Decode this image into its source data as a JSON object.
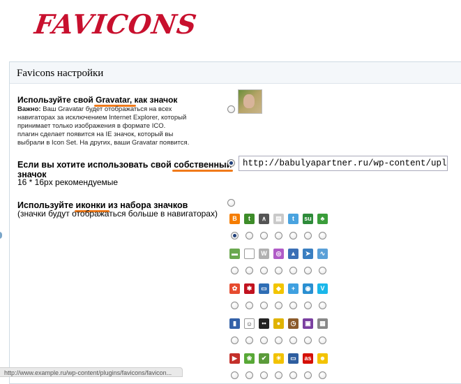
{
  "logo": {
    "text": "FAVICONS"
  },
  "panel": {
    "title": "Favicons настройки"
  },
  "gravatar_option": {
    "heading_pre": "Используйте свой ",
    "heading_u": "Gravatar, ",
    "heading_post": "как значок",
    "note_label": "Важно:",
    "note_lines": [
      " Ваш Gravatar будет отображаться на всех",
      "навигаторах за исключением Internet Explorer, который",
      "принимает только изображения в формате ICO.",
      "плагин сделает появится на IE значок, который вы",
      "выбрали в Icon Set. На других, ваши Gravatar появится."
    ],
    "selected": false
  },
  "custom_option": {
    "heading_pre": "Если вы хотите использовать свой ",
    "heading_u": "собственный",
    "heading_line2": "значок",
    "hint": "16 * 16px рекомендуемые",
    "url_value": "http://babulyapartner.ru/wp-content/uploac",
    "selected": true
  },
  "iconset_option": {
    "heading_pre": "Используйте ",
    "heading_u": "иконки ",
    "heading_post": "из набора значков",
    "sub": "(значки будут отображаться больше в навигаторах)",
    "selected": false
  },
  "icon_rows": [
    {
      "icons": [
        {
          "name": "blogger-icon",
          "color": "#f57d00",
          "glyph": "B"
        },
        {
          "name": "brightkite-icon",
          "color": "#3d8c29",
          "glyph": "t"
        },
        {
          "name": "bebo-icon",
          "color": "#555555",
          "glyph": "∧"
        },
        {
          "name": "posterous-icon",
          "color": "#c9c9c9",
          "glyph": "▤"
        },
        {
          "name": "twitter-icon",
          "color": "#4aa3df",
          "glyph": "t"
        },
        {
          "name": "stumbleupon-icon",
          "color": "#2e8b3a",
          "glyph": "su"
        },
        {
          "name": "tree-icon",
          "color": "#3a9d3a",
          "glyph": "♣"
        }
      ],
      "selected": 0
    },
    {
      "icons": [
        {
          "name": "landscape-icon",
          "color": "#6aa84f",
          "glyph": "▬"
        },
        {
          "name": "blank-icon",
          "color": "#ffffff",
          "glyph": ""
        },
        {
          "name": "wordpress-icon",
          "color": "#b0b0b0",
          "glyph": "W"
        },
        {
          "name": "ubuntu-icon",
          "color": "#b05bc7",
          "glyph": "◎"
        },
        {
          "name": "bird-icon",
          "color": "#3b6fb6",
          "glyph": "▲"
        },
        {
          "name": "twitter-bird-icon",
          "color": "#3a7fc1",
          "glyph": "➤"
        },
        {
          "name": "activity-icon",
          "color": "#5aa0d8",
          "glyph": "∿"
        }
      ],
      "selected": -1
    },
    {
      "icons": [
        {
          "name": "picasa-icon",
          "color": "#e64b2f",
          "glyph": "✿"
        },
        {
          "name": "debian-icon",
          "color": "#c1121f",
          "glyph": "✱"
        },
        {
          "name": "monitor-icon",
          "color": "#2f6eb5",
          "glyph": "▭"
        },
        {
          "name": "yahoo-messenger-icon",
          "color": "#f2c500",
          "glyph": "◆"
        },
        {
          "name": "plus-icon",
          "color": "#3fa0e0",
          "glyph": "+"
        },
        {
          "name": "target-icon",
          "color": "#2a8fd1",
          "glyph": "◉"
        },
        {
          "name": "vimeo-icon",
          "color": "#1ab7ea",
          "glyph": "V"
        }
      ],
      "selected": -1
    },
    {
      "icons": [
        {
          "name": "book-icon",
          "color": "#3361a8",
          "glyph": "▮"
        },
        {
          "name": "reddit-icon",
          "color": "#ffffff",
          "glyph": "☺"
        },
        {
          "name": "flickr-icon",
          "color": "#222222",
          "glyph": "••"
        },
        {
          "name": "coin-icon",
          "color": "#e0b300",
          "glyph": "●"
        },
        {
          "name": "clock-icon",
          "color": "#8b5a2b",
          "glyph": "◷"
        },
        {
          "name": "tv-icon",
          "color": "#7a3fa0",
          "glyph": "▣"
        },
        {
          "name": "camera-icon",
          "color": "#888888",
          "glyph": "▦"
        }
      ],
      "selected": -1
    },
    {
      "icons": [
        {
          "name": "youtube-icon",
          "color": "#c4302b",
          "glyph": "▶"
        },
        {
          "name": "leaf-icon",
          "color": "#58a836",
          "glyph": "❀"
        },
        {
          "name": "checkbox-icon",
          "color": "#5b9b3a",
          "glyph": "✔"
        },
        {
          "name": "sun-icon",
          "color": "#f2c200",
          "glyph": "☀"
        },
        {
          "name": "screen-icon",
          "color": "#2e5e9f",
          "glyph": "▭"
        },
        {
          "name": "lastfm-icon",
          "color": "#d51007",
          "glyph": "as"
        },
        {
          "name": "smiley-icon",
          "color": "#f3c300",
          "glyph": "☻"
        }
      ],
      "selected": -1
    }
  ],
  "status_bar": {
    "text": "http://www.example.ru/wp-content/plugins/favicons/favicon..."
  }
}
